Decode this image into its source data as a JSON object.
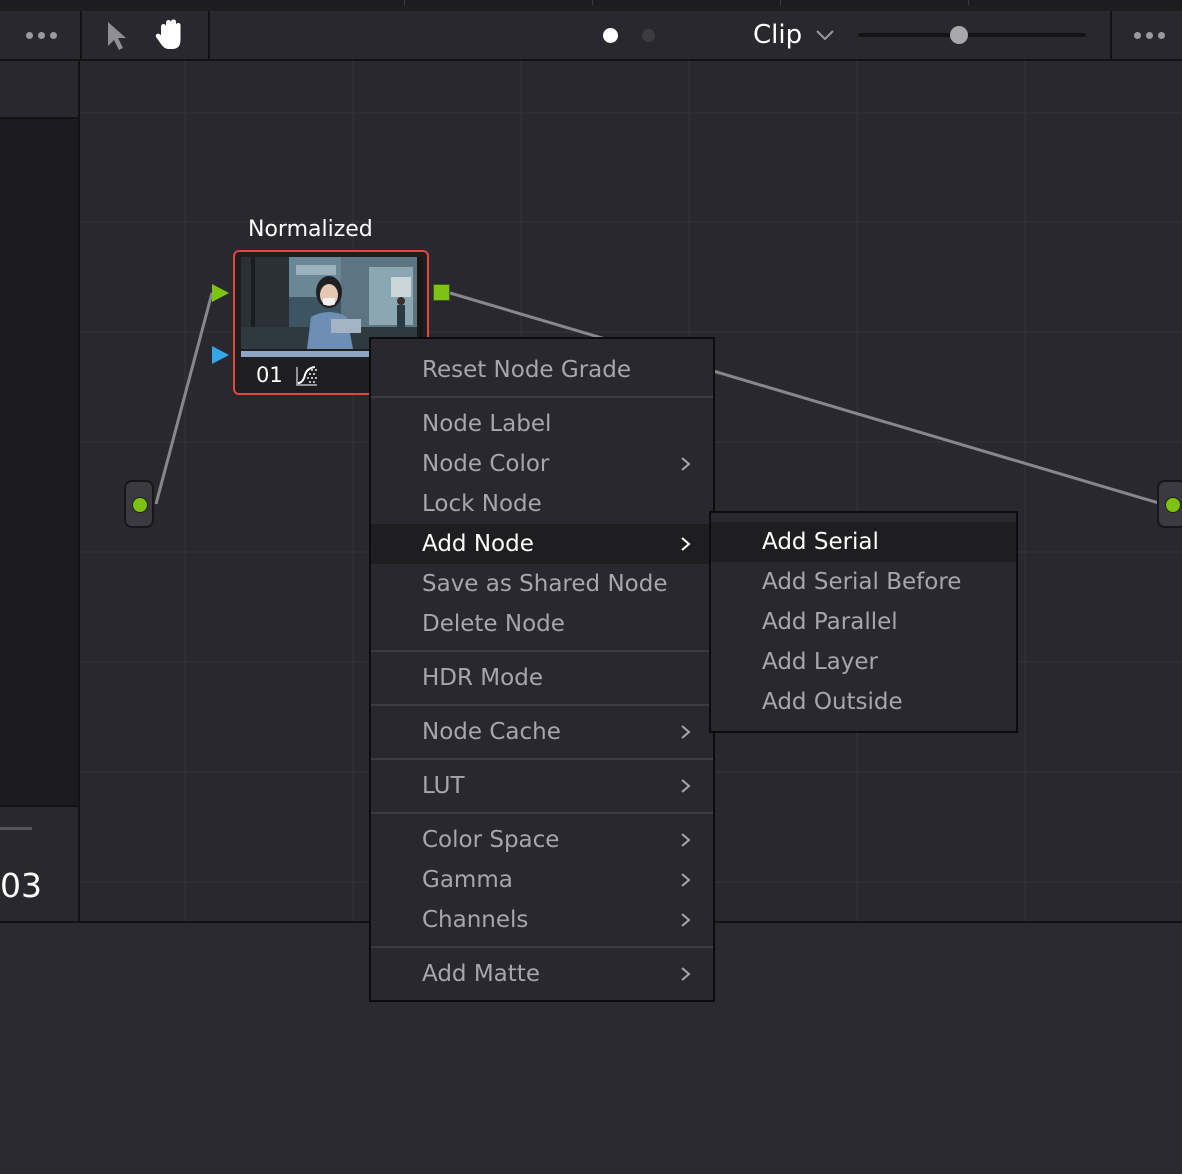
{
  "toolbar": {
    "left_more_icon": "more-horizontal-icon",
    "tool_pointer_icon": "pointer-arrow-icon",
    "tool_hand_icon": "hand-pan-icon",
    "mode_label": "Clip",
    "right_more_icon": "more-horizontal-icon"
  },
  "left_panel": {
    "clip_number": "03"
  },
  "node": {
    "label": "Normalized",
    "number": "01"
  },
  "context_menu": {
    "items": [
      {
        "label": "Reset Node Grade"
      },
      {
        "label": "Node Label"
      },
      {
        "label": "Node Color"
      },
      {
        "label": "Lock Node"
      },
      {
        "label": "Add Node"
      },
      {
        "label": "Save as Shared Node"
      },
      {
        "label": "Delete Node"
      },
      {
        "label": "HDR Mode"
      },
      {
        "label": "Node Cache"
      },
      {
        "label": "LUT"
      },
      {
        "label": "Color Space"
      },
      {
        "label": "Gamma"
      },
      {
        "label": "Channels"
      },
      {
        "label": "Add Matte"
      }
    ],
    "highlighted": "Add Node"
  },
  "submenu": {
    "items": [
      {
        "label": "Add Serial"
      },
      {
        "label": "Add Serial Before"
      },
      {
        "label": "Add Parallel"
      },
      {
        "label": "Add Layer"
      },
      {
        "label": "Add Outside"
      }
    ],
    "highlighted": "Add Serial"
  },
  "colors": {
    "background": "#28282e",
    "node_border": "#e2463c",
    "input_green": "#7cc316",
    "input_blue": "#36a6e8",
    "menu_text": "#a6a6ac",
    "menu_highlight_text": "#ffffff"
  }
}
